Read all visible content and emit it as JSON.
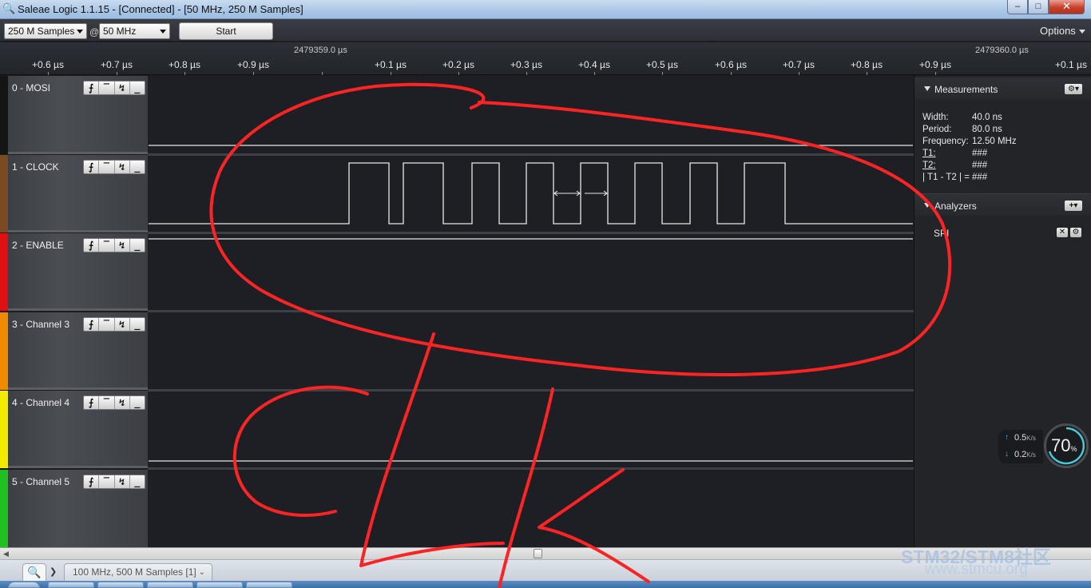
{
  "window": {
    "title": "Saleae Logic 1.1.15 - [Connected] - [50 MHz, 250 M Samples]",
    "min": "–",
    "max": "□",
    "close": "✕"
  },
  "toolbar": {
    "samples": "250 M Samples",
    "at": "@",
    "rate": "50 MHz",
    "start": "Start",
    "options": "Options"
  },
  "ruler": {
    "abs_left": "2479359.0 µs",
    "abs_right": "2479360.0 µs",
    "ticks": [
      "+0.6 µs",
      "+0.7 µs",
      "+0.8 µs",
      "+0.9 µs",
      "+0.1 µs",
      "+0.2 µs",
      "+0.3 µs",
      "+0.4 µs",
      "+0.5 µs",
      "+0.6 µs",
      "+0.7 µs",
      "+0.8 µs",
      "+0.9 µs",
      "+0.1 µs"
    ]
  },
  "channels": [
    {
      "name": "0 - MOSI",
      "color": "#151515"
    },
    {
      "name": "1 - CLOCK",
      "color": "#7a4b22"
    },
    {
      "name": "2 - ENABLE",
      "color": "#e01010"
    },
    {
      "name": "3 - Channel 3",
      "color": "#f08a00"
    },
    {
      "name": "4 - Channel 4",
      "color": "#f2ea00"
    },
    {
      "name": "5 - Channel 5",
      "color": "#21c021"
    }
  ],
  "trigger_buttons": [
    "⨍",
    "‾",
    "↯",
    "_"
  ],
  "measurements": {
    "title": "Measurements",
    "rows": [
      {
        "k": "Width:",
        "v": "40.0 ns"
      },
      {
        "k": "Period:",
        "v": "80.0 ns"
      },
      {
        "k": "Frequency:",
        "v": "12.50 MHz"
      },
      {
        "k": "T1:",
        "v": "###"
      },
      {
        "k": "T2:",
        "v": "###"
      },
      {
        "k": "| T1 - T2 | =",
        "v": "###"
      }
    ]
  },
  "analyzers": {
    "title": "Analyzers",
    "items": [
      "SPI"
    ]
  },
  "stats": {
    "up": "0.5",
    "down": "0.2",
    "unit": "K/s",
    "cpu": "70",
    "cpu_unit": "%"
  },
  "session_tab": "100 MHz, 500 M Samples [1]",
  "watermark": {
    "line1": "STM32/STM8社区",
    "line2": "www.stmcu.org"
  }
}
